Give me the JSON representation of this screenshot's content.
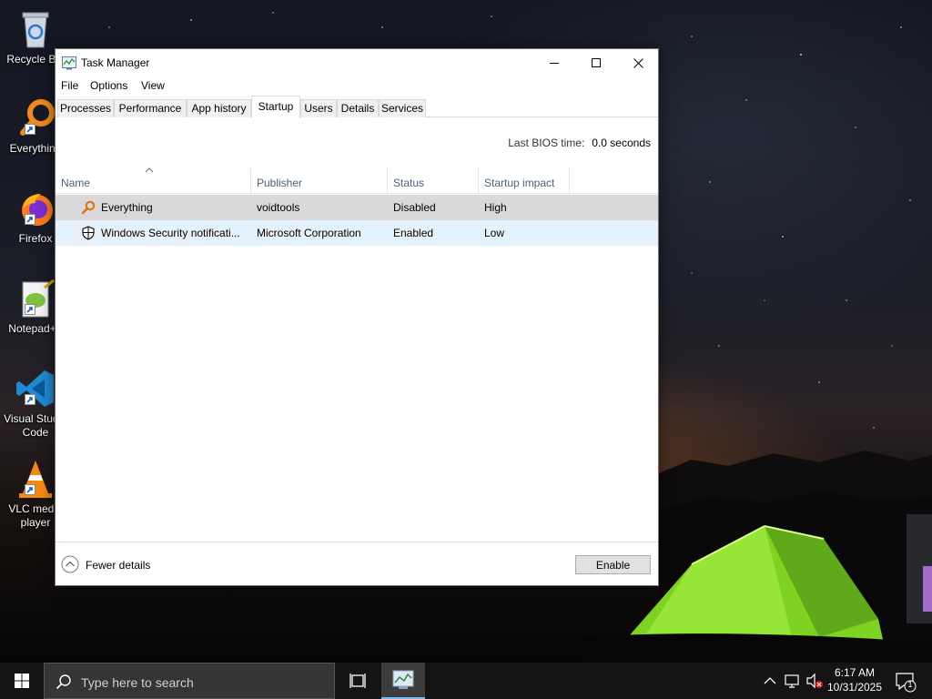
{
  "desktop": {
    "icons": [
      {
        "name": "recycle-bin",
        "label": "Recycle Bin"
      },
      {
        "name": "everything",
        "label": "Everything"
      },
      {
        "name": "firefox",
        "label": "Firefox"
      },
      {
        "name": "notepad-plus-plus",
        "label": "Notepad++"
      },
      {
        "name": "visual-studio-code",
        "label": "Visual Studio Code"
      },
      {
        "name": "vlc-media-player",
        "label": "VLC media player"
      }
    ]
  },
  "window": {
    "title": "Task Manager",
    "icon": "task-manager-icon",
    "controls": {
      "minimize": "minimize-icon",
      "maximize": "maximize-icon",
      "close": "close-icon"
    }
  },
  "menu": {
    "file": "File",
    "options": "Options",
    "view": "View"
  },
  "tabs": [
    {
      "label": "Processes",
      "active": false
    },
    {
      "label": "Performance",
      "active": false
    },
    {
      "label": "App history",
      "active": false
    },
    {
      "label": "Startup",
      "active": true
    },
    {
      "label": "Users",
      "active": false
    },
    {
      "label": "Details",
      "active": false
    },
    {
      "label": "Services",
      "active": false
    }
  ],
  "bios": {
    "label": "Last BIOS time:",
    "value": "0.0 seconds"
  },
  "columns": {
    "name": "Name",
    "publisher": "Publisher",
    "status": "Status",
    "impact": "Startup impact"
  },
  "rows": [
    {
      "icon": "everything-magnifier-icon",
      "name": "Everything",
      "publisher": "voidtools",
      "status": "Disabled",
      "impact": "High",
      "selected": true
    },
    {
      "icon": "shield-icon",
      "name": "Windows Security notificati...",
      "publisher": "Microsoft Corporation",
      "status": "Enabled",
      "impact": "Low",
      "selected": false
    }
  ],
  "footer": {
    "fewer_details": "Fewer details",
    "enable_button": "Enable"
  },
  "taskbar": {
    "search_placeholder": "Type here to search",
    "time": "6:17 AM",
    "date": "10/31/2025",
    "notification_count": "1"
  },
  "colors": {
    "accent": "#76b9ed",
    "selected_row": "#d9d9d9",
    "hover_row": "#e5f1fb",
    "taskbar": "#141414"
  }
}
